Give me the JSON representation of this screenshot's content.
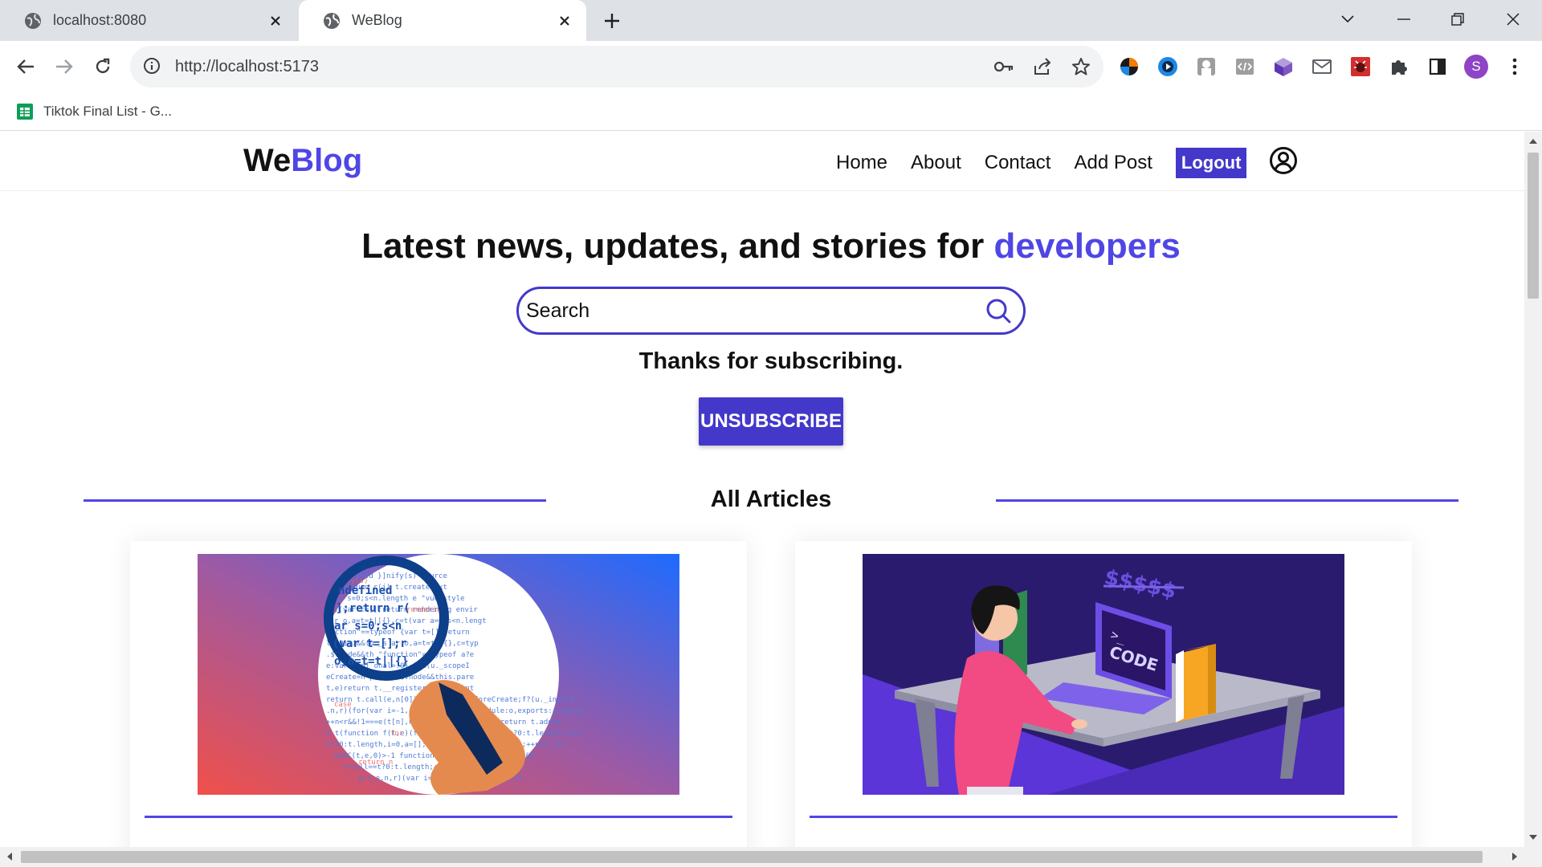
{
  "browser": {
    "tabs": [
      {
        "title": "localhost:8080",
        "active": false
      },
      {
        "title": "WeBlog",
        "active": true
      }
    ],
    "url": "http://localhost:5173",
    "profile_initial": "S",
    "bookmarks": [
      {
        "label": "Tiktok Final List - G..."
      }
    ]
  },
  "site": {
    "logo_part1": "We",
    "logo_part2": "Blog",
    "nav": {
      "home": "Home",
      "about": "About",
      "contact": "Contact",
      "add_post": "Add Post",
      "logout": "Logout"
    }
  },
  "hero": {
    "headline_main": "Latest news, updates, and stories for ",
    "headline_accent": "developers",
    "search_placeholder": "Search"
  },
  "subscription": {
    "message": "Thanks for subscribing.",
    "button": "UNSUBSCRIBE"
  },
  "articles": {
    "section_title": "All Articles",
    "cards": [
      {
        "image": "magnifying-glass-code-illustration"
      },
      {
        "image": "developer-laptop-code-illustration"
      }
    ]
  },
  "colors": {
    "accent": "#4f46e5",
    "button": "#4338ca"
  }
}
